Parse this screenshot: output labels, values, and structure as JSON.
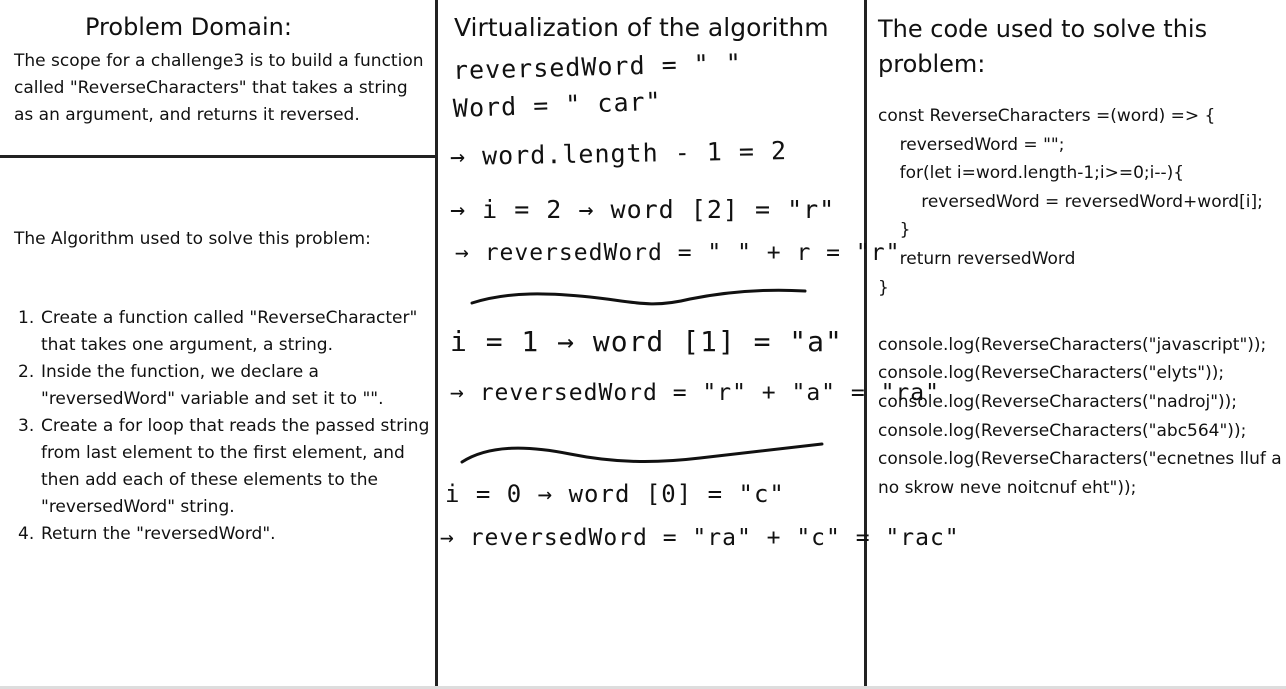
{
  "problem_domain": {
    "title": "Problem Domain:",
    "scope": "The scope for a challenge3 is to build a function called \"ReverseCharacters\" that takes a string as an argument, and returns it reversed."
  },
  "algorithm": {
    "heading": "The Algorithm used to solve this problem:",
    "steps": [
      {
        "num": "1.",
        "text": "Create a function called \"ReverseCharacter\" that takes one argument, a string."
      },
      {
        "num": "2.",
        "text": "Inside the function, we declare a \"reversedWord\" variable and set it to \"\"."
      },
      {
        "num": "3.",
        "text": "Create a for loop that reads the passed string from last element to the first element, and then add each of these elements to the \"reversedWord\" string."
      },
      {
        "num": "4.",
        "text": "Return the \"reversedWord\"."
      }
    ]
  },
  "visualization": {
    "title": "Virtualization of the algorithm",
    "handwritten": [
      "reversedWord = \" \"",
      "Word = \" car\"",
      "→ word.length - 1 = 2",
      "→ i = 2 → word [2] = \"r\"",
      "→ reversedWord = \" \" + r = \"r\"",
      "i = 1 → word [1] = \"a\"",
      "→ reversedWord = \"r\" + \"a\" = \"ra\"",
      "i = 0 → word [0] = \"c\"",
      "→ reversedWord = \"ra\" + \"c\" = \"rac\""
    ]
  },
  "code": {
    "title": "The code used to solve this problem:",
    "lines": [
      "const ReverseCharacters =(word) => {",
      "    reversedWord = \"\";",
      "    for(let i=word.length-1;i>=0;i--){",
      "        reversedWord = reversedWord+word[i];",
      "    }",
      "    return reversedWord",
      "}",
      "",
      "console.log(ReverseCharacters(\"javascript\"));",
      "console.log(ReverseCharacters(\"elyts\"));",
      "console.log(ReverseCharacters(\"nadroj\"));",
      "console.log(ReverseCharacters(\"abc564\"));",
      "console.log(ReverseCharacters(\"ecnetnes lluf a no skrow neve noitcnuf eht\"));"
    ]
  }
}
